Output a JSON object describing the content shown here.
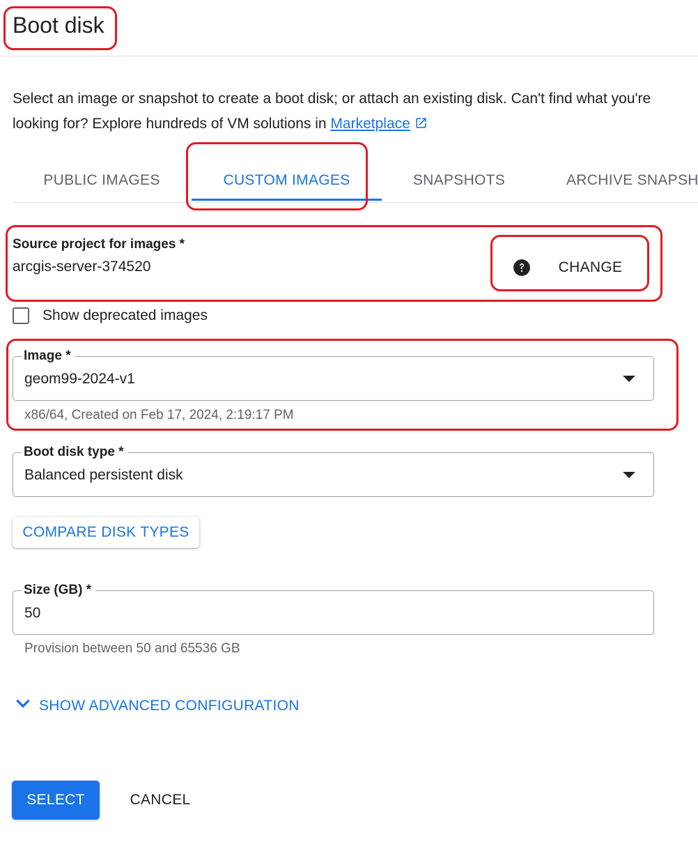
{
  "panel": {
    "title": "Boot disk",
    "description_text": "Select an image or snapshot to create a boot disk; or attach an existing disk. Can't find what you're looking for? Explore hundreds of VM solutions in",
    "marketplace_link": "Marketplace"
  },
  "tabs": [
    {
      "label": "PUBLIC IMAGES",
      "active": false
    },
    {
      "label": "CUSTOM IMAGES",
      "active": true
    },
    {
      "label": "SNAPSHOTS",
      "active": false
    },
    {
      "label": "ARCHIVE SNAPSHOTS",
      "active": false
    }
  ],
  "source_project": {
    "label": "Source project for images *",
    "value": "arcgis-server-374520",
    "change_label": "CHANGE"
  },
  "deprecated_checkbox": {
    "label": "Show deprecated images",
    "checked": false
  },
  "image_field": {
    "label": "Image *",
    "value": "geom99-2024-v1",
    "helper": "x86/64, Created on Feb 17, 2024, 2:19:17 PM"
  },
  "boot_disk_type": {
    "label": "Boot disk type *",
    "value": "Balanced persistent disk"
  },
  "compare_button": "COMPARE DISK TYPES",
  "size_field": {
    "label": "Size (GB) *",
    "value": "50",
    "helper": "Provision between 50 and 65536 GB"
  },
  "advanced_link": "SHOW ADVANCED CONFIGURATION",
  "actions": {
    "select": "SELECT",
    "cancel": "CANCEL"
  },
  "icons": {
    "external_link": "external-link-icon",
    "help": "help-icon",
    "dropdown": "dropdown-arrow-icon",
    "chevron": "chevron-down-icon"
  },
  "colors": {
    "accent": "#1a73e8",
    "annotation": "#e01b24",
    "text": "#202124",
    "secondary_text": "#5f6368"
  }
}
